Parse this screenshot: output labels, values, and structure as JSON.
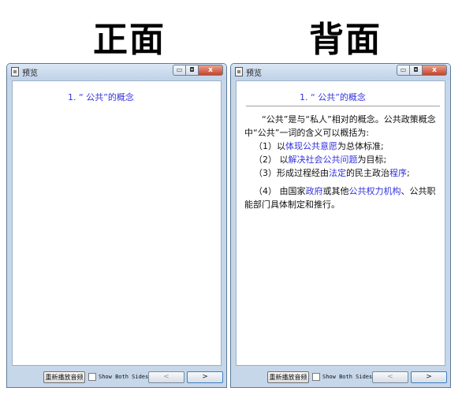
{
  "headings": {
    "front": "正面",
    "back": "背面"
  },
  "window": {
    "title": "预览",
    "min_glyph": "▭",
    "max_glyph": "◘",
    "close_glyph": "x"
  },
  "card": {
    "question": "1. “ 公共”的概念",
    "answer_intro": "“公共”是与“私人”相对的概念。公共政策概念中“公共”一词的含义可以概括为:",
    "items": [
      {
        "prefix": "（1）以",
        "hl": "体现公共意愿",
        "suffix": "为总体标准;"
      },
      {
        "prefix": "（2） 以",
        "hl": "解决社会公共问题",
        "suffix": "为目标;"
      },
      {
        "prefix": "（3）形成过程经由",
        "hl": "法定",
        "suffix": "的民主政治",
        "hl2": "程序",
        "suffix2": ";"
      },
      {
        "prefix": "（4） 由国家",
        "hl": "政府",
        "suffix": "或其他",
        "hl2": "公共权力机构",
        "suffix2": "、公共职能部门具体制定和推行。"
      }
    ]
  },
  "bottombar": {
    "replay_label": "重新播放音频",
    "show_both_label": "Show Both Sides",
    "show_both_checked": false,
    "prev_label": "<",
    "next_label": ">"
  },
  "colors": {
    "highlight": "#3333dd",
    "window_frame": "#c6d7ea"
  }
}
